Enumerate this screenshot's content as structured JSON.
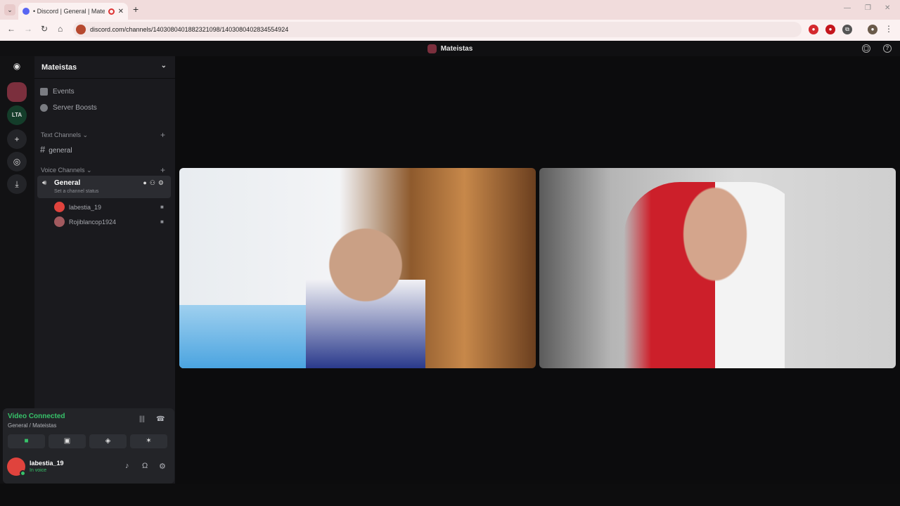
{
  "browser": {
    "tab_title": "• Discord | General | Mateist",
    "url": "discord.com/channels/1403080401882321098/1403080402834554924"
  },
  "discord": {
    "window_title": "Mateistas",
    "server_name": "Mateistas",
    "guild_lta": "LTA",
    "menu": {
      "events": "Events",
      "boosts": "Server Boosts"
    },
    "text_category": "Text Channels",
    "text_channel": "general",
    "voice_category": "Voice Channels",
    "voice_channel": "General",
    "voice_status": "Set a channel status",
    "members": [
      "labestia_19",
      "Rojiblancop1924"
    ],
    "voice_panel": {
      "status": "Video Connected",
      "location": "General / Mateistas"
    },
    "user": {
      "name": "labestia_19",
      "status": "In voice"
    }
  },
  "colors": {
    "accent": "#5865f2",
    "connected": "#37c26a",
    "sidebar": "#1a1a1e"
  }
}
